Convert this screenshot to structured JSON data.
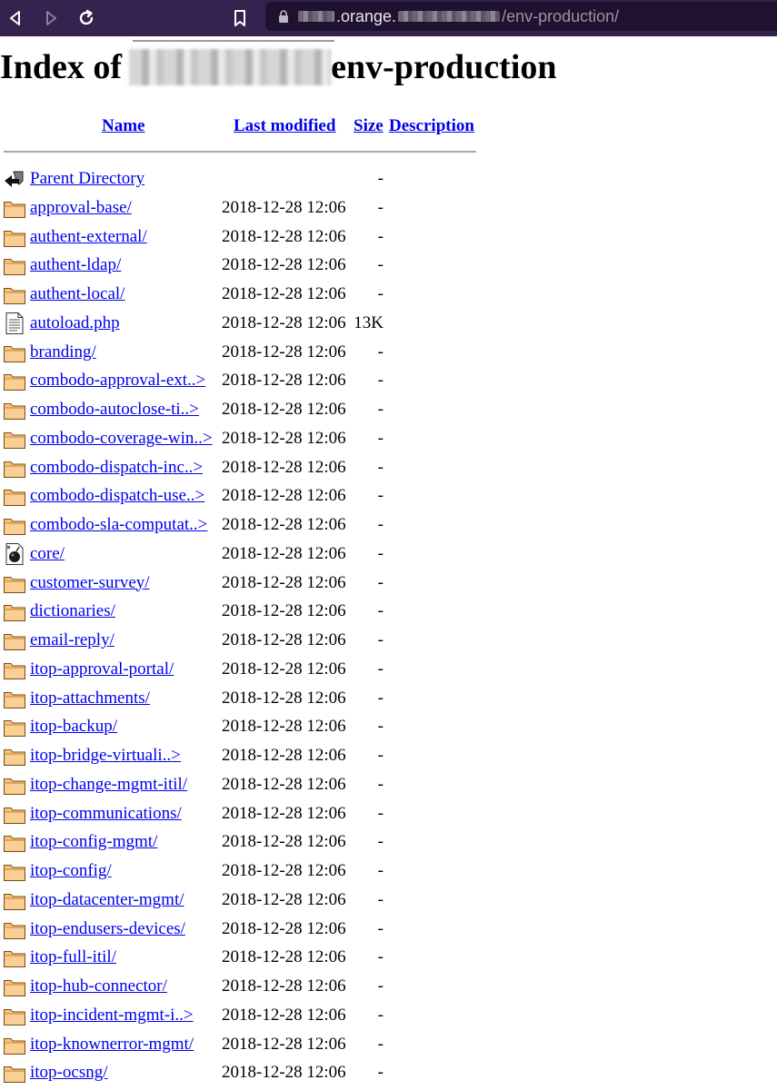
{
  "browser": {
    "url_prefix_hidden": true,
    "url_visible_parts": [
      ".orange.",
      "/env-production/"
    ],
    "colors": {
      "chrome_bg": "#36224e",
      "url_bg": "#1f1230"
    }
  },
  "page": {
    "title_prefix": "Index of ",
    "title_suffix": "env-production",
    "columns": {
      "name": "Name",
      "modified": "Last modified",
      "size": "Size",
      "description": "Description"
    },
    "parent": {
      "name": "Parent Directory",
      "date": "",
      "size": "-",
      "icon": "back-icon"
    },
    "entries": [
      {
        "name": "approval-base/",
        "date": "2018-12-28 12:06",
        "size": "-",
        "icon": "folder-icon"
      },
      {
        "name": "authent-external/",
        "date": "2018-12-28 12:06",
        "size": "-",
        "icon": "folder-icon"
      },
      {
        "name": "authent-ldap/",
        "date": "2018-12-28 12:06",
        "size": "-",
        "icon": "folder-icon"
      },
      {
        "name": "authent-local/",
        "date": "2018-12-28 12:06",
        "size": "-",
        "icon": "folder-icon"
      },
      {
        "name": "autoload.php",
        "date": "2018-12-28 12:06",
        "size": "13K",
        "icon": "text-file-icon"
      },
      {
        "name": "branding/",
        "date": "2018-12-28 12:06",
        "size": "-",
        "icon": "folder-icon"
      },
      {
        "name": "combodo-approval-ext..>",
        "date": "2018-12-28 12:06",
        "size": "-",
        "icon": "folder-icon"
      },
      {
        "name": "combodo-autoclose-ti..>",
        "date": "2018-12-28 12:06",
        "size": "-",
        "icon": "folder-icon"
      },
      {
        "name": "combodo-coverage-win..>",
        "date": "2018-12-28 12:06",
        "size": "-",
        "icon": "folder-icon"
      },
      {
        "name": "combodo-dispatch-inc..>",
        "date": "2018-12-28 12:06",
        "size": "-",
        "icon": "folder-icon"
      },
      {
        "name": "combodo-dispatch-use..>",
        "date": "2018-12-28 12:06",
        "size": "-",
        "icon": "folder-icon"
      },
      {
        "name": "combodo-sla-computat..>",
        "date": "2018-12-28 12:06",
        "size": "-",
        "icon": "folder-icon"
      },
      {
        "name": "core/",
        "date": "2018-12-28 12:06",
        "size": "-",
        "icon": "bomb-icon"
      },
      {
        "name": "customer-survey/",
        "date": "2018-12-28 12:06",
        "size": "-",
        "icon": "folder-icon"
      },
      {
        "name": "dictionaries/",
        "date": "2018-12-28 12:06",
        "size": "-",
        "icon": "folder-icon"
      },
      {
        "name": "email-reply/",
        "date": "2018-12-28 12:06",
        "size": "-",
        "icon": "folder-icon"
      },
      {
        "name": "itop-approval-portal/",
        "date": "2018-12-28 12:06",
        "size": "-",
        "icon": "folder-icon"
      },
      {
        "name": "itop-attachments/",
        "date": "2018-12-28 12:06",
        "size": "-",
        "icon": "folder-icon"
      },
      {
        "name": "itop-backup/",
        "date": "2018-12-28 12:06",
        "size": "-",
        "icon": "folder-icon"
      },
      {
        "name": "itop-bridge-virtuali..>",
        "date": "2018-12-28 12:06",
        "size": "-",
        "icon": "folder-icon"
      },
      {
        "name": "itop-change-mgmt-itil/",
        "date": "2018-12-28 12:06",
        "size": "-",
        "icon": "folder-icon"
      },
      {
        "name": "itop-communications/",
        "date": "2018-12-28 12:06",
        "size": "-",
        "icon": "folder-icon"
      },
      {
        "name": "itop-config-mgmt/",
        "date": "2018-12-28 12:06",
        "size": "-",
        "icon": "folder-icon"
      },
      {
        "name": "itop-config/",
        "date": "2018-12-28 12:06",
        "size": "-",
        "icon": "folder-icon"
      },
      {
        "name": "itop-datacenter-mgmt/",
        "date": "2018-12-28 12:06",
        "size": "-",
        "icon": "folder-icon"
      },
      {
        "name": "itop-endusers-devices/",
        "date": "2018-12-28 12:06",
        "size": "-",
        "icon": "folder-icon"
      },
      {
        "name": "itop-full-itil/",
        "date": "2018-12-28 12:06",
        "size": "-",
        "icon": "folder-icon"
      },
      {
        "name": "itop-hub-connector/",
        "date": "2018-12-28 12:06",
        "size": "-",
        "icon": "folder-icon"
      },
      {
        "name": "itop-incident-mgmt-i..>",
        "date": "2018-12-28 12:06",
        "size": "-",
        "icon": "folder-icon"
      },
      {
        "name": "itop-knownerror-mgmt/",
        "date": "2018-12-28 12:06",
        "size": "-",
        "icon": "folder-icon"
      },
      {
        "name": "itop-ocsng/",
        "date": "2018-12-28 12:06",
        "size": "-",
        "icon": "folder-icon"
      }
    ],
    "colors": {
      "link": "#0000ee",
      "folder_fill": "#f6c27e",
      "folder_stroke": "#8a5a1e"
    }
  }
}
